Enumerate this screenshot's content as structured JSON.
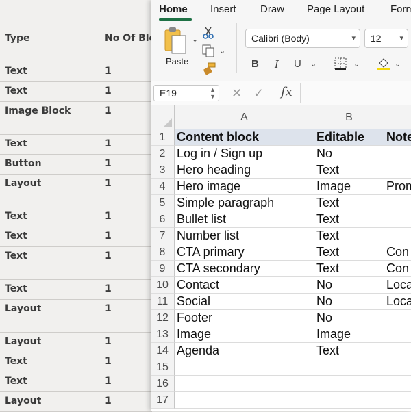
{
  "background_sheet": {
    "headers": [
      "Type",
      "No Of Blo"
    ],
    "rows": [
      {
        "type": "Text",
        "count": "1"
      },
      {
        "type": "Text",
        "count": "1"
      },
      {
        "type": "Image Block",
        "count": "1"
      },
      {
        "type": "Text",
        "count": "1"
      },
      {
        "type": "Button",
        "count": "1"
      },
      {
        "type": "Layout",
        "count": "1"
      },
      {
        "type": "Text",
        "count": "1"
      },
      {
        "type": "Text",
        "count": "1"
      },
      {
        "type": "Text",
        "count": "1"
      },
      {
        "type": "Text",
        "count": "1"
      },
      {
        "type": "Layout",
        "count": "1"
      },
      {
        "type": "Layout",
        "count": "1"
      },
      {
        "type": "Text",
        "count": "1"
      },
      {
        "type": "Text",
        "count": "1"
      },
      {
        "type": "Layout",
        "count": "1"
      }
    ]
  },
  "ribbon": {
    "tabs": [
      "Home",
      "Insert",
      "Draw",
      "Page Layout",
      "Form"
    ],
    "active_tab": "Home",
    "paste_label": "Paste",
    "font_name": "Calibri (Body)",
    "font_size": "12",
    "bold_glyph": "B",
    "italic_glyph": "I",
    "underline_glyph": "U",
    "accent_color": "#1e7145"
  },
  "formula_bar": {
    "name_box": "E19",
    "fx": "fx",
    "formula": ""
  },
  "sheet": {
    "columns": [
      "A",
      "B"
    ],
    "row_numbers": [
      "1",
      "2",
      "3",
      "4",
      "5",
      "6",
      "7",
      "8",
      "9",
      "10",
      "11",
      "12",
      "13",
      "14",
      "15",
      "16",
      "17"
    ],
    "rows": [
      [
        "Content block",
        "Editable",
        "Note"
      ],
      [
        "Log in / Sign up",
        "No",
        ""
      ],
      [
        "Hero heading",
        "Text",
        ""
      ],
      [
        "Hero image",
        "Image",
        "Prom"
      ],
      [
        "Simple paragraph",
        "Text",
        ""
      ],
      [
        "Bullet list",
        "Text",
        ""
      ],
      [
        "Number list",
        "Text",
        ""
      ],
      [
        "CTA primary",
        "Text",
        "Con"
      ],
      [
        "CTA secondary",
        "Text",
        "Con"
      ],
      [
        "Contact",
        "No",
        "Loca"
      ],
      [
        "Social",
        "No",
        "Loca"
      ],
      [
        "Footer",
        "No",
        ""
      ],
      [
        "Image",
        "Image",
        ""
      ],
      [
        "Agenda",
        "Text",
        ""
      ],
      [
        "",
        "",
        ""
      ],
      [
        "",
        "",
        ""
      ],
      [
        "",
        "",
        ""
      ]
    ]
  }
}
